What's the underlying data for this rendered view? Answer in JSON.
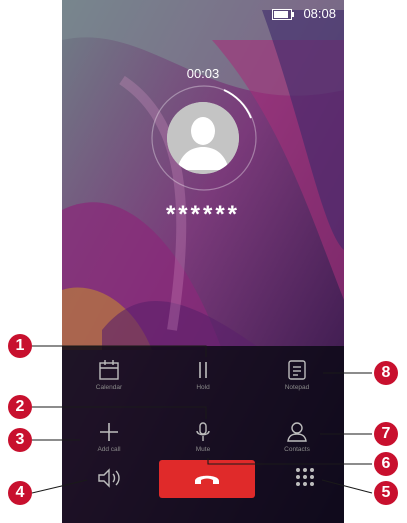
{
  "status_bar": {
    "time": "08:08",
    "battery_level": 0.9
  },
  "call": {
    "duration": "00:03",
    "caller_number": "******"
  },
  "actions": [
    {
      "id": "calendar",
      "label": "Calendar",
      "icon": "calendar-icon"
    },
    {
      "id": "hold",
      "label": "Hold",
      "icon": "pause-icon"
    },
    {
      "id": "notepad",
      "label": "Notepad",
      "icon": "notepad-icon"
    },
    {
      "id": "add-call",
      "label": "Add call",
      "icon": "plus-icon"
    },
    {
      "id": "mute",
      "label": "Mute",
      "icon": "microphone-icon"
    },
    {
      "id": "contacts",
      "label": "Contacts",
      "icon": "person-icon"
    }
  ],
  "bottom_bar": {
    "speaker_icon": "speaker-icon",
    "end_call_icon": "end-call-icon",
    "dialpad_icon": "dialpad-icon",
    "end_call_color": "#e02a2a"
  },
  "callouts": [
    "1",
    "2",
    "3",
    "4",
    "5",
    "6",
    "7",
    "8"
  ],
  "colors": {
    "callout": "#c8102e",
    "label": "#8a8a8a"
  }
}
